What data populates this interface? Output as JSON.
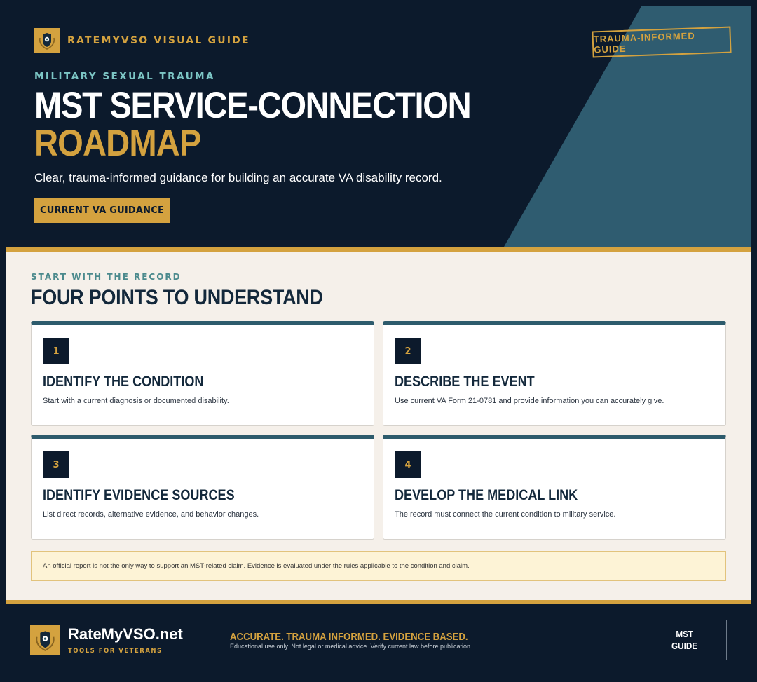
{
  "header": {
    "brand": "RATEMYVSO VISUAL GUIDE",
    "stamp": "TRAUMA-INFORMED GUIDE",
    "eyebrow": "MILITARY SEXUAL TRAUMA",
    "title_line1": "MST SERVICE-CONNECTION",
    "title_line2": "ROADMAP",
    "subtitle": "Clear, trauma-informed guidance for building an accurate VA disability record.",
    "cta_label": "CURRENT VA GUIDANCE"
  },
  "section": {
    "eyebrow": "START WITH THE RECORD",
    "title": "FOUR POINTS TO UNDERSTAND",
    "cards": [
      {
        "number": "1",
        "title": "IDENTIFY THE CONDITION",
        "description": "Start with a current diagnosis or documented disability."
      },
      {
        "number": "2",
        "title": "DESCRIBE THE EVENT",
        "description": "Use current VA Form 21-0781 and provide information you can accurately give."
      },
      {
        "number": "3",
        "title": "IDENTIFY EVIDENCE SOURCES",
        "description": "List direct records, alternative evidence, and behavior changes."
      },
      {
        "number": "4",
        "title": "DEVELOP THE MEDICAL LINK",
        "description": "The record must connect the current condition to military service."
      }
    ],
    "note": "An official report is not the only way to support an MST-related claim. Evidence is evaluated under the rules applicable to the condition and claim."
  },
  "footer": {
    "site_name": "RateMyVSO.net",
    "tagline": "TOOLS FOR VETERANS",
    "motto": "ACCURATE. TRAUMA INFORMED. EVIDENCE BASED.",
    "disclaimer": "Educational use only. Not legal or medical advice. Verify current law before publication.",
    "badge_line1": "MST",
    "badge_line2": "GUIDE"
  },
  "colors": {
    "navy": "#0c1a2c",
    "gold": "#d4a23f",
    "teal": "#2d5b6c",
    "aqua": "#7cc6c5",
    "cream": "#f5f0ea",
    "note_bg": "#fdf3d6"
  },
  "icons": {
    "seal": "eagle-shield-icon"
  }
}
